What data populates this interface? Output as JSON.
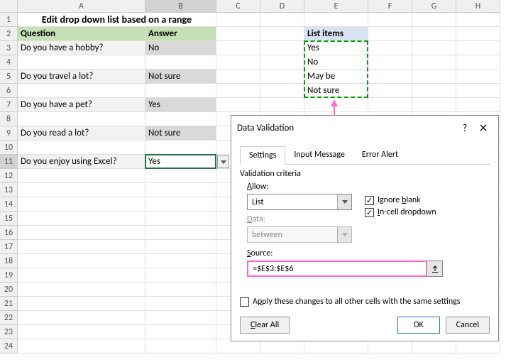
{
  "cols": [
    "A",
    "B",
    "C",
    "D",
    "E",
    "F",
    "G",
    "H"
  ],
  "rows": [
    "1",
    "2",
    "3",
    "4",
    "5",
    "6",
    "7",
    "8",
    "9",
    "10",
    "11",
    "12",
    "13",
    "14",
    "15",
    "16",
    "17",
    "18",
    "19",
    "20",
    "21",
    "22",
    "23",
    "24"
  ],
  "title": "Edit drop down list based on a range",
  "headers": {
    "question": "Question",
    "answer": "Answer",
    "list_items": "List items"
  },
  "questions": {
    "r3": "Do you have a hobby?",
    "r5": "Do you travel a lot?",
    "r7": "Do you have a pet?",
    "r9": "Do you read a lot?",
    "r11": "Do you enjoy using Excel?"
  },
  "answers": {
    "r3": "No",
    "r5": "Not sure",
    "r7": "Yes",
    "r9": "Not sure",
    "r11": "Yes"
  },
  "list_items": {
    "r3": "Yes",
    "r4": "No",
    "r5": "May be",
    "r6": "Not sure"
  },
  "dialog": {
    "title": "Data Validation",
    "tabs": {
      "settings": "Settings",
      "input_msg": "Input Message",
      "error_alert": "Error Alert"
    },
    "criteria_label": "Validation criteria",
    "allow_label": "Allow:",
    "allow_value": "List",
    "data_label": "Data:",
    "data_value": "between",
    "ignore_blank": "Ignore blank",
    "incell_dd": "In-cell dropdown",
    "source_label": "Source:",
    "source_value": "=$E$3:$E$6",
    "apply_label": "Apply these changes to all other cells with the same settings",
    "clear_all": "Clear All",
    "ok": "OK",
    "cancel": "Cancel"
  }
}
